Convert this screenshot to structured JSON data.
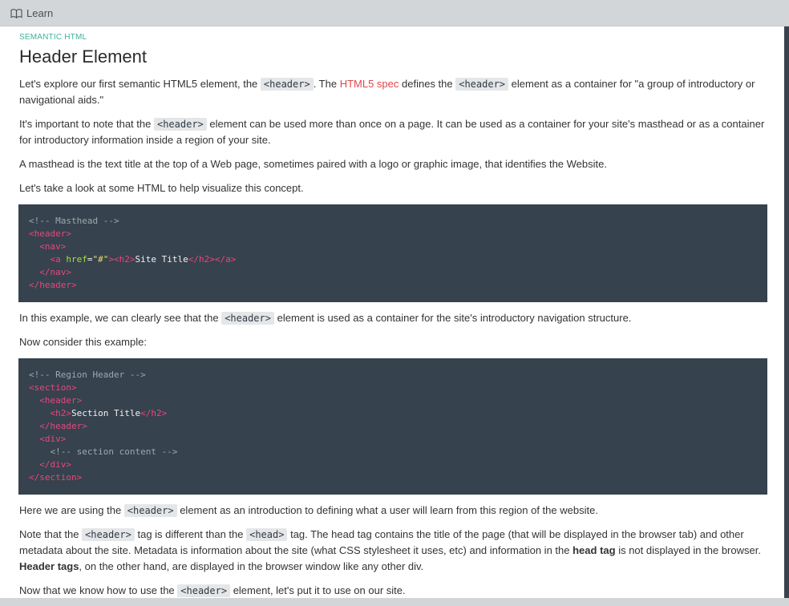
{
  "topbar": {
    "title": "Learn",
    "icon": "book-icon"
  },
  "lesson": {
    "eyebrow": "SEMANTIC HTML",
    "title": "Header Element",
    "p1": {
      "a": "Let's explore our first semantic HTML5 element, the ",
      "code1": "<header>",
      "b": ". The ",
      "link": "HTML5 spec",
      "c": " defines the ",
      "code2": "<header>",
      "d": " element as a container for \"a group of introductory or navigational aids.\""
    },
    "p2": {
      "a": "It's important to note that the ",
      "code": "<header>",
      "b": " element can be used more than once on a page. It can be used as a container for your site's masthead or as a container for introductory information inside a region of your site."
    },
    "p3": "A masthead is the text title at the top of a Web page, sometimes paired with a logo or graphic image, that identifies the Website.",
    "p4": "Let's take a look at some HTML to help visualize this concept.",
    "code1": {
      "comment": "<!-- Masthead -->",
      "header_open": "<header>",
      "nav_open": "<nav>",
      "a_open": "<a ",
      "href_attr": "href",
      "eq": "=",
      "href_val": "\"#\"",
      "gt": ">",
      "h2_open": "<h2>",
      "site_title": "Site Title",
      "h2_close": "</h2>",
      "a_close": "</a>",
      "nav_close": "</nav>",
      "header_close": "</header>"
    },
    "p5": {
      "a": "In this example, we can clearly see that the ",
      "code": "<header>",
      "b": " element is used as a container for the site's introductory navigation structure."
    },
    "p6": "Now consider this example:",
    "code2": {
      "comment": "<!-- Region Header -->",
      "section_open": "<section>",
      "header_open": "<header>",
      "h2_open": "<h2>",
      "section_title": "Section Title",
      "h2_close": "</h2>",
      "header_close": "</header>",
      "div_open": "<div>",
      "content_comment": "<!-- section content -->",
      "div_close": "</div>",
      "section_close": "</section>"
    },
    "p7": {
      "a": "Here we are using the ",
      "code": "<header>",
      "b": " element as an introduction to defining what a user will learn from this region of the website."
    },
    "p8": {
      "a": "Note that the ",
      "code1": "<header>",
      "b": " tag is different than the ",
      "code2": "<head>",
      "c": " tag. The head tag contains the title of the page (that will be displayed in the browser tab) and other metadata about the site. Metadata is information about the site (what CSS stylesheet it uses, etc) and information in the ",
      "bold1": "head tag",
      "d": " is not displayed in the browser. ",
      "bold2": "Header tags",
      "e": ", on the other hand, are displayed in the browser window like any other div."
    },
    "p9": {
      "a": "Now that we know how to use the ",
      "code": "<header>",
      "b": " element, let's put it to use on our site."
    }
  }
}
